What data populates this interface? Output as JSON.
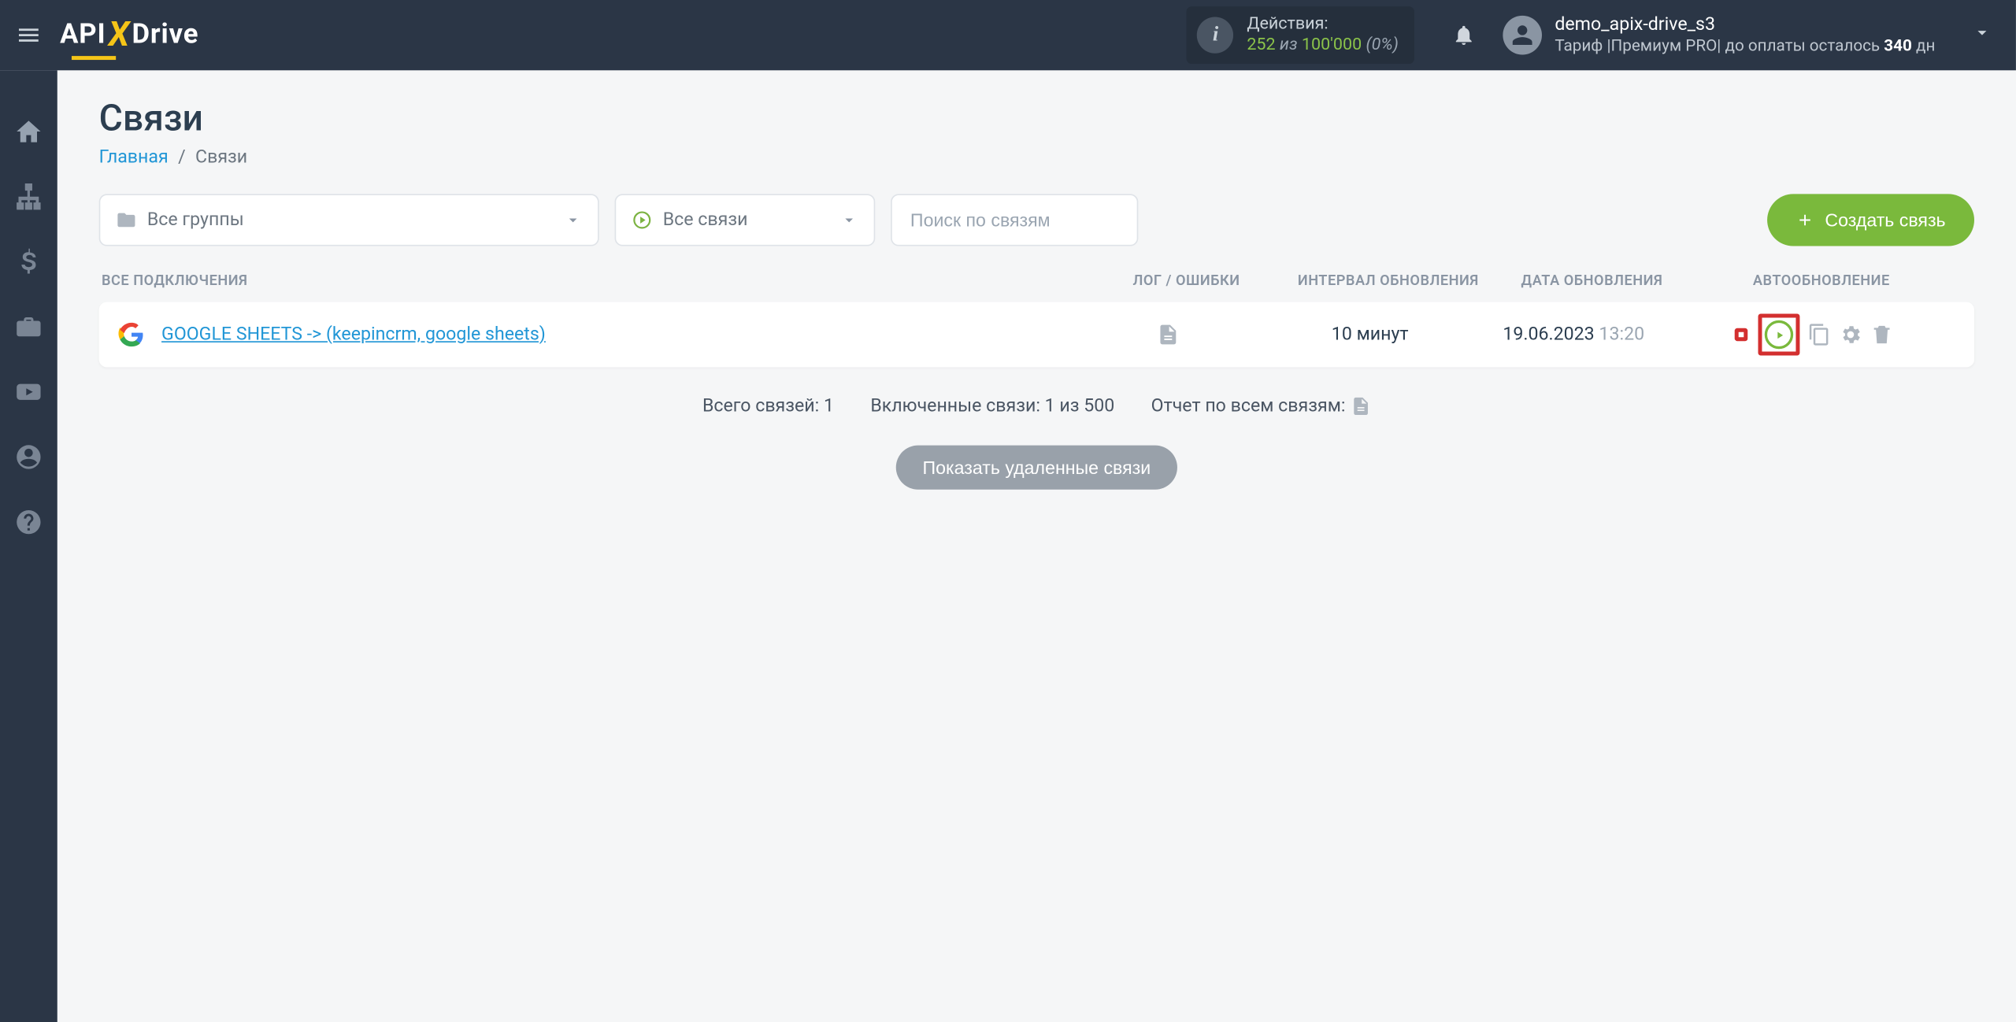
{
  "header": {
    "logo_parts": {
      "api": "API",
      "drive": "Drive"
    },
    "actions": {
      "label": "Действия:",
      "used": "252",
      "iz": "из",
      "total": "100'000",
      "pct": "(0%)"
    },
    "user": {
      "name": "demo_apix-drive_s3",
      "tariff_prefix": "Тариф |Премиум PRO|  до оплаты осталось ",
      "days_num": "340",
      "days_suffix": " дн"
    }
  },
  "page": {
    "title": "Связи",
    "breadcrumb": {
      "home": "Главная",
      "current": "Связи"
    }
  },
  "filters": {
    "groups_label": "Все группы",
    "status_label": "Все связи",
    "search_placeholder": "Поиск по связям"
  },
  "create_btn": "Создать связь",
  "table": {
    "headers": {
      "all": "ВСЕ ПОДКЛЮЧЕНИЯ",
      "log": "ЛОГ / ОШИБКИ",
      "interval": "ИНТЕРВАЛ ОБНОВЛЕНИЯ",
      "date": "ДАТА ОБНОВЛЕНИЯ",
      "auto": "АВТООБНОВЛЕНИЕ"
    },
    "rows": [
      {
        "name": "GOOGLE SHEETS -> (keepincrm, google sheets)",
        "interval": "10 минут",
        "date": "19.06.2023",
        "time": "13:20",
        "auto_on": true
      }
    ]
  },
  "stats": {
    "total": "Всего связей: 1",
    "enabled": "Включенные связи: 1 из 500",
    "report": "Отчет по всем связям:"
  },
  "show_deleted": "Показать удаленные связи"
}
